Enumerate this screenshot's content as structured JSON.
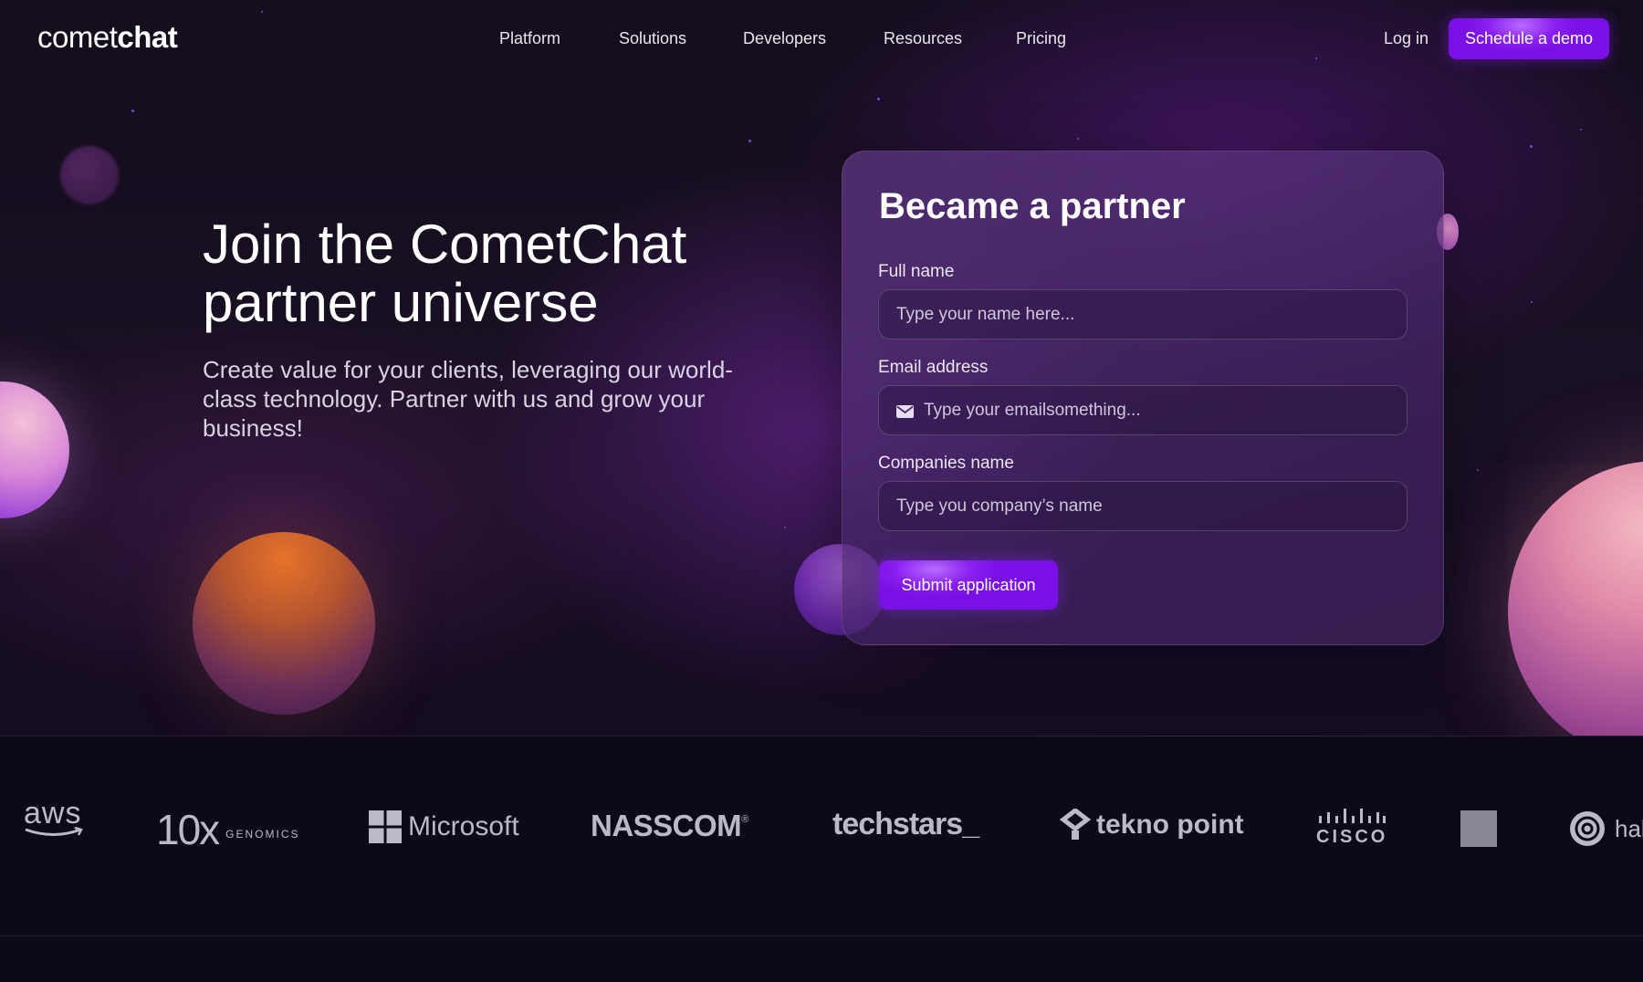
{
  "nav": {
    "logo_light": "comet",
    "logo_bold": "chat",
    "links": [
      "Platform",
      "Solutions",
      "Developers",
      "Resources",
      "Pricing"
    ],
    "login": "Log in",
    "demo_button": "Schedule a demo"
  },
  "hero": {
    "title": "Join the CometChat partner universe",
    "subtitle": "Create value for your clients, leveraging our world-class technology. Partner with us and grow your business!"
  },
  "form": {
    "title": "Became a partner",
    "fields": [
      {
        "label": "Full name",
        "placeholder": "Type your name here..."
      },
      {
        "label": "Email address",
        "placeholder": "Type your emailsomething..."
      },
      {
        "label": "Companies name",
        "placeholder": "Type you company’s name"
      }
    ],
    "submit": "Submit application"
  },
  "partners": {
    "aws": "aws",
    "tenx": "10x",
    "tenx_sub": "GENOMICS",
    "microsoft": "Microsoft",
    "nasscom": "NASSCOM",
    "nasscom_mark": "®",
    "techstars": "techstars_",
    "teknopoint": "tekno point",
    "cisco": "CISCO",
    "partial": "hak"
  },
  "colors": {
    "accent": "#7b10e6",
    "background": "#0e0a1a",
    "card": "#4a2a6e"
  }
}
